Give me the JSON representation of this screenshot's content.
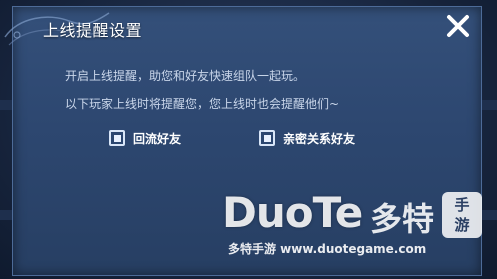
{
  "dialog": {
    "title": "上线提醒设置",
    "close_icon": "close-x-icon",
    "intro_text": "开启上线提醒，助您和好友快速组队一起玩。",
    "note_text": "以下玩家上线时将提醒您，您上线时也会提醒他们~",
    "options": [
      {
        "label": "回流好友",
        "checked": true
      },
      {
        "label": "亲密关系好友",
        "checked": true
      }
    ]
  },
  "watermark": {
    "logo_text": "DuoTe",
    "logo_cn": "多特",
    "seal_top": "手",
    "seal_bottom": "游",
    "subtitle": "多特手游 www.duotegame.com"
  },
  "colors": {
    "dialog_bg": "#2d4770",
    "dialog_border": "#4d6b98",
    "text_primary": "#ffffff",
    "text_secondary": "#c9d6ea"
  }
}
